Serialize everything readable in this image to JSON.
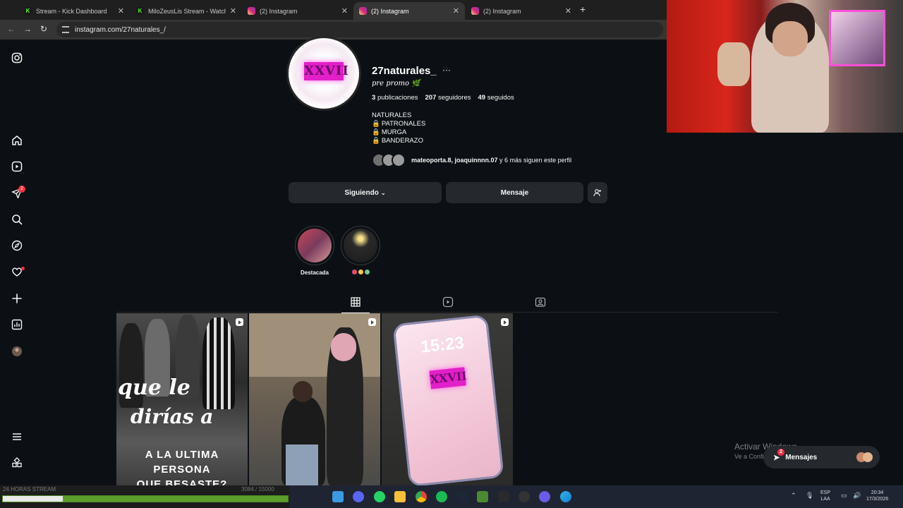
{
  "browser": {
    "tabs": [
      {
        "title": "Stream - Kick Dashboard",
        "favicon": "kick-icon"
      },
      {
        "title": "MiloZeusLis Stream - Watch Li",
        "favicon": "kick-icon"
      },
      {
        "title": "(2) Instagram",
        "favicon": "instagram-icon"
      },
      {
        "title": "(2) Instagram",
        "favicon": "instagram-icon",
        "active": true
      },
      {
        "title": "(2) Instagram",
        "favicon": "instagram-icon"
      }
    ],
    "url": "instagram.com/27naturales_/"
  },
  "sidebar": {
    "notification_count": "2"
  },
  "profile": {
    "username": "27naturales_",
    "display_name": "pre promo",
    "avatar_text": "XXVII",
    "stats": {
      "posts": "3",
      "posts_label": "publicaciones",
      "followers": "207",
      "followers_label": "seguidores",
      "following": "49",
      "following_label": "seguidos"
    },
    "bio": [
      "NATURALES",
      "PATRONALES",
      "MURGA",
      "BANDERAZO"
    ],
    "followed_by_names": "mateoporta.8, joaquinnnn.07",
    "followed_by_rest": "y 6 más siguen este perfil",
    "follow_button": "Siguiendo",
    "message_button": "Mensaje"
  },
  "highlights": [
    {
      "label": "Destacada"
    },
    {
      "label": ""
    }
  ],
  "posts": {
    "p1": {
      "line1": "que le",
      "line2": "dirías a",
      "line3": "A LA ULTIMA",
      "line4": "PERSONA",
      "line5": "QUE BESASTE?"
    },
    "p3": {
      "time": "15:23",
      "logo": "XXVII"
    }
  },
  "overlay": {
    "windows_activate_title": "Activar Windows",
    "windows_activate_sub": "Ve a Configuración para activar Windows.",
    "messages_pill": "Mensajes",
    "messages_count": "2",
    "stream_label": "24 HORAS STREAM",
    "stream_count": "3084",
    "stream_goal": "15000",
    "stream_progress": 0.21
  },
  "taskbar": {
    "lang_top": "ESP",
    "lang_bottom": "LAA",
    "time": "20:34",
    "date": "17/3/2026"
  }
}
